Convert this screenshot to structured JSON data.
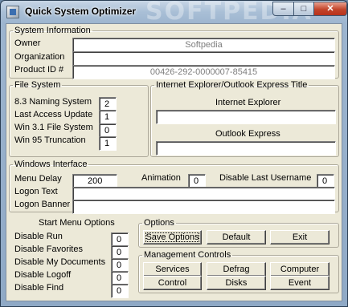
{
  "window": {
    "title": "Quick System Optimizer",
    "minimize_glyph": "–",
    "maximize_glyph": "□",
    "close_glyph": "✕"
  },
  "system_information": {
    "title": "System Information",
    "owner_label": "Owner",
    "owner_value": "Softpedia",
    "organization_label": "Organization",
    "organization_value": "",
    "product_id_label": "Product ID #",
    "product_id_value": "00426-292-0000007-85415"
  },
  "file_system": {
    "title": "File System",
    "items": [
      {
        "label": "8.3 Naming System",
        "value": "2"
      },
      {
        "label": "Last Access Update",
        "value": "1"
      },
      {
        "label": "Win 3.1 File System",
        "value": "0"
      },
      {
        "label": "Win 95 Truncation",
        "value": "1"
      }
    ]
  },
  "ie_outlook": {
    "title": "Internet Explorer/Outlook Express Title",
    "ie_label": "Internet Explorer",
    "ie_value": "",
    "oe_label": "Outlook Express",
    "oe_value": ""
  },
  "windows_interface": {
    "title": "Windows Interface",
    "menu_delay_label": "Menu Delay",
    "menu_delay_value": "200",
    "animation_label": "Animation",
    "animation_value": "0",
    "disable_last_username_label": "Disable Last Username",
    "disable_last_username_value": "0",
    "logon_text_label": "Logon Text",
    "logon_text_value": "",
    "logon_banner_label": "Logon Banner",
    "logon_banner_value": ""
  },
  "start_menu": {
    "title": "Start Menu Options",
    "items": [
      {
        "label": "Disable Run",
        "value": "0"
      },
      {
        "label": "Disable Favorites",
        "value": "0"
      },
      {
        "label": "Disable My Documents",
        "value": "0"
      },
      {
        "label": "Disable Logoff",
        "value": "0"
      },
      {
        "label": "Disable Find",
        "value": "0"
      }
    ]
  },
  "options": {
    "title": "Options",
    "save_label": "Save Options",
    "default_label": "Default",
    "exit_label": "Exit"
  },
  "management": {
    "title": "Management Controls",
    "services_label": "Services",
    "defrag_label": "Defrag",
    "computer_label": "Computer",
    "control_label": "Control",
    "disks_label": "Disks",
    "event_label": "Event"
  },
  "watermark": "SOFTPEDIA"
}
